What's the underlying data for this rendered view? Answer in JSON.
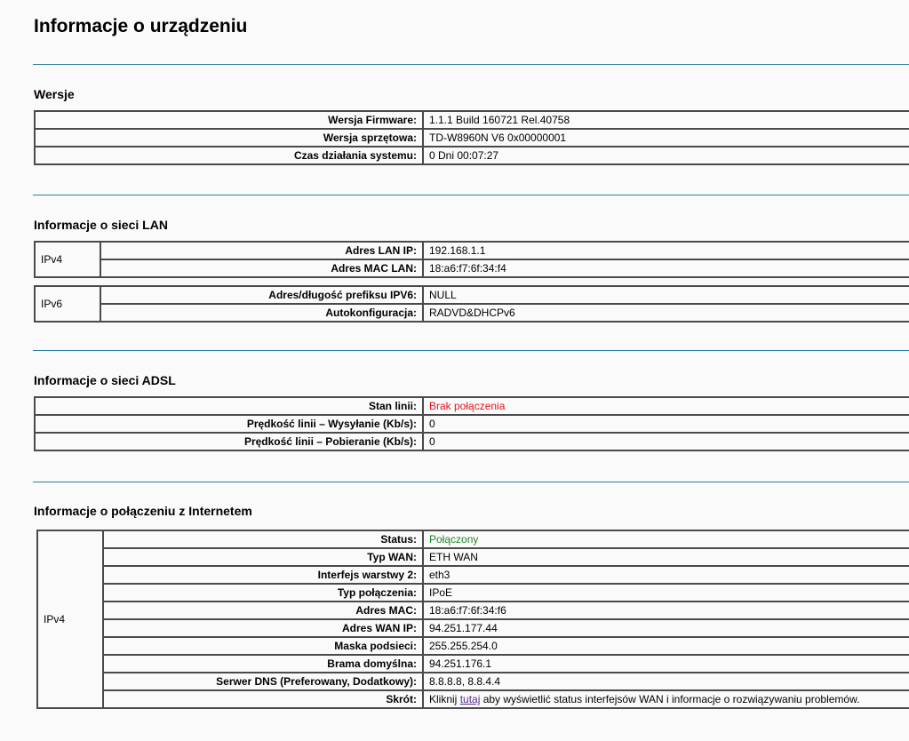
{
  "page": {
    "title": "Informacje o urządzeniu"
  },
  "versions": {
    "title": "Wersje",
    "rows": [
      {
        "label": "Wersja Firmware:",
        "value": "1.1.1 Build 160721 Rel.40758"
      },
      {
        "label": "Wersja sprzętowa:",
        "value": "TD-W8960N V6 0x00000001"
      },
      {
        "label": "Czas działania systemu:",
        "value": "0 Dni 00:07:27"
      }
    ]
  },
  "lan": {
    "title": "Informacje o sieci LAN",
    "ipv4": {
      "group": "IPv4",
      "rows": [
        {
          "label": "Adres LAN IP:",
          "value": "192.168.1.1"
        },
        {
          "label": "Adres MAC LAN:",
          "value": "18:a6:f7:6f:34:f4"
        }
      ]
    },
    "ipv6": {
      "group": "IPv6",
      "rows": [
        {
          "label": "Adres/długość prefiksu IPV6:",
          "value": "NULL"
        },
        {
          "label": "Autokonfiguracja:",
          "value": "RADVD&DHCPv6"
        }
      ]
    }
  },
  "adsl": {
    "title": "Informacje o sieci ADSL",
    "rows": [
      {
        "label": "Stan linii:",
        "value": "Brak połączenia"
      },
      {
        "label": "Prędkość linii – Wysyłanie (Kb/s):",
        "value": "0"
      },
      {
        "label": "Prędkość linii – Pobieranie (Kb/s):",
        "value": "0"
      }
    ]
  },
  "internet": {
    "title": "Informacje o połączeniu z Internetem",
    "group": "IPv4",
    "rows": [
      {
        "label": "Status:",
        "value": "Połączony"
      },
      {
        "label": "Typ WAN:",
        "value": "ETH WAN"
      },
      {
        "label": "Interfejs warstwy 2:",
        "value": "eth3"
      },
      {
        "label": "Typ połączenia:",
        "value": "IPoE"
      },
      {
        "label": "Adres MAC:",
        "value": "18:a6:f7:6f:34:f6"
      },
      {
        "label": "Adres WAN IP:",
        "value": "94.251.177.44"
      },
      {
        "label": "Maska podsieci:",
        "value": "255.255.254.0"
      },
      {
        "label": "Brama domyślna:",
        "value": "94.251.176.1"
      },
      {
        "label": "Serwer DNS (Preferowany, Dodatkowy):",
        "value": "8.8.8.8, 8.8.4.4"
      }
    ],
    "shortcut": {
      "label": "Skrót:",
      "prefix": "Kliknij ",
      "link": "tutaj",
      "suffix": " aby wyświetlić status interfejsów WAN i informacje o rozwiązywaniu problemów."
    }
  },
  "colors": {
    "divider": "#2f7ca3",
    "status_error": "#e0141e",
    "status_ok": "#21862a",
    "link": "#5b2c8f"
  }
}
